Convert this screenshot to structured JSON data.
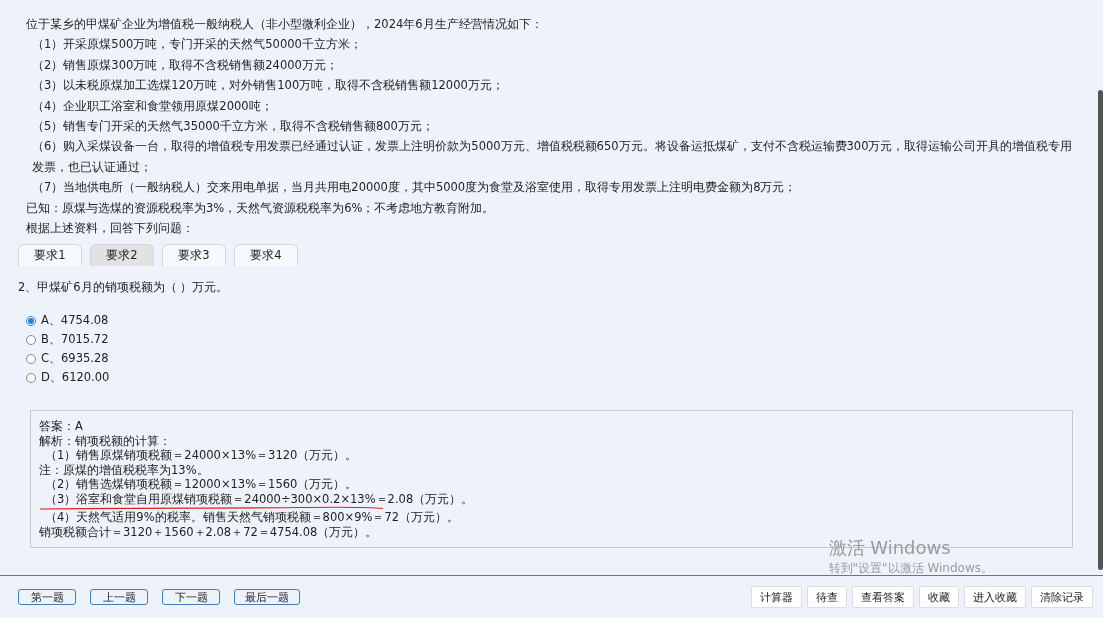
{
  "question_intro": [
    "位于某乡的甲煤矿企业为增值税一般纳税人（非小型微利企业），2024年6月生产经营情况如下：",
    "（1）开采原煤500万吨，专门开采的天然气50000千立方米；",
    "（2）销售原煤300万吨，取得不含税销售额24000万元；",
    "（3）以未税原煤加工选煤120万吨，对外销售100万吨，取得不含税销售额12000万元；",
    "（4）企业职工浴室和食堂领用原煤2000吨；",
    "（5）销售专门开采的天然气35000千立方米，取得不含税销售额800万元；",
    "（6）购入采煤设备一台，取得的增值税专用发票已经通过认证，发票上注明价款为5000万元、增值税税额650万元。将设备运抵煤矿，支付不含税运输费300万元，取得运输公司开具的增值税专用发票，也已认证通过；",
    "（7）当地供电所（一般纳税人）交来用电单据，当月共用电20000度，其中5000度为食堂及浴室使用，取得专用发票上注明电费金额为8万元；",
    "已知：原煤与选煤的资源税税率为3%，天然气资源税税率为6%；不考虑地方教育附加。",
    "根据上述资料，回答下列问题："
  ],
  "tabs": [
    {
      "label": "要求1",
      "selected": false
    },
    {
      "label": "要求2",
      "selected": true
    },
    {
      "label": "要求3",
      "selected": false
    },
    {
      "label": "要求4",
      "selected": false
    }
  ],
  "question": "2、甲煤矿6月的销项税额为（    ）万元。",
  "options": [
    {
      "label": "A、4754.08",
      "selected": true
    },
    {
      "label": "B、7015.72",
      "selected": false
    },
    {
      "label": "C、6935.28",
      "selected": false
    },
    {
      "label": "D、6120.00",
      "selected": false
    }
  ],
  "answer_lines": [
    "答案：A",
    "解析：销项税额的计算：",
    "（1）销售原煤销项税额＝24000×13%＝3120（万元）。",
    "注：原煤的增值税税率为13%。",
    "（2）销售选煤销项税额＝12000×13%＝1560（万元）。",
    "（3）浴室和食堂自用原煤销项税额＝24000÷300×0.2×13%＝2.08（万元）。",
    "（4）天然气适用9%的税率。销售天然气销项税额＝800×9%＝72（万元）。",
    "销项税额合计＝3120＋1560＋2.08＋72＝4754.08（万元）。"
  ],
  "nav_buttons": [
    "第一题",
    "上一题",
    "下一题",
    "最后一题"
  ],
  "tool_buttons": [
    "计算器",
    "待查",
    "查看答案",
    "收藏",
    "进入收藏",
    "清除记录"
  ],
  "os_notice": {
    "title": "激活 Windows",
    "subtitle": "转到\"设置\"以激活 Windows。"
  }
}
